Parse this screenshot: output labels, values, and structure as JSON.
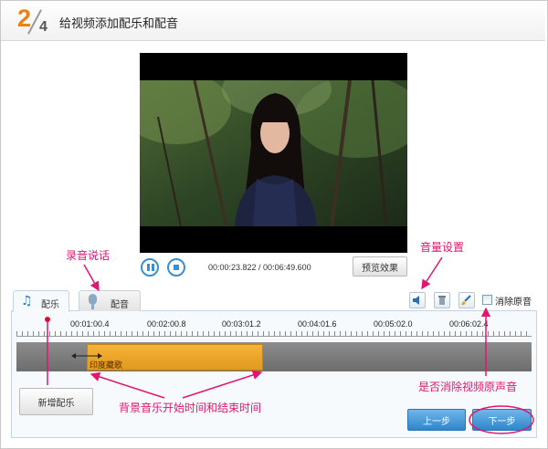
{
  "header": {
    "step_current": "2",
    "step_total": "4",
    "title": "给视频添加配乐和配音"
  },
  "playback": {
    "time": "00:00:23.822 / 00:06:49.600",
    "preview_label": "预览效果"
  },
  "tabs": [
    {
      "label": "配乐",
      "icon": "music-note-icon",
      "active": true
    },
    {
      "label": "配音",
      "icon": "microphone-icon",
      "active": false
    }
  ],
  "tools": {
    "volume_icon": "speaker-icon",
    "delete_icon": "trash-icon",
    "clear_icon": "brush-icon",
    "mute_original_label": "消除原音",
    "mute_original_checked": false
  },
  "timeline": {
    "ticks": [
      "00:01:00.4",
      "00:02:00.8",
      "00:03:01.2",
      "00:04:01.6",
      "00:05:02.0",
      "00:06:02.4"
    ],
    "clip_label": "印度藏歌"
  },
  "buttons": {
    "add_music": "新增配乐",
    "prev": "上一步",
    "next": "下一步"
  },
  "annotations": {
    "record": "录音说话",
    "volume": "音量设置",
    "bg_music_time": "背景音乐开始时间和结束时间",
    "mute_original": "是否消除视频原声音"
  },
  "colors": {
    "accent": "#f07f12",
    "annotation": "#e01670",
    "primary_button": "#2f86cc",
    "clip": "#e8a022"
  }
}
